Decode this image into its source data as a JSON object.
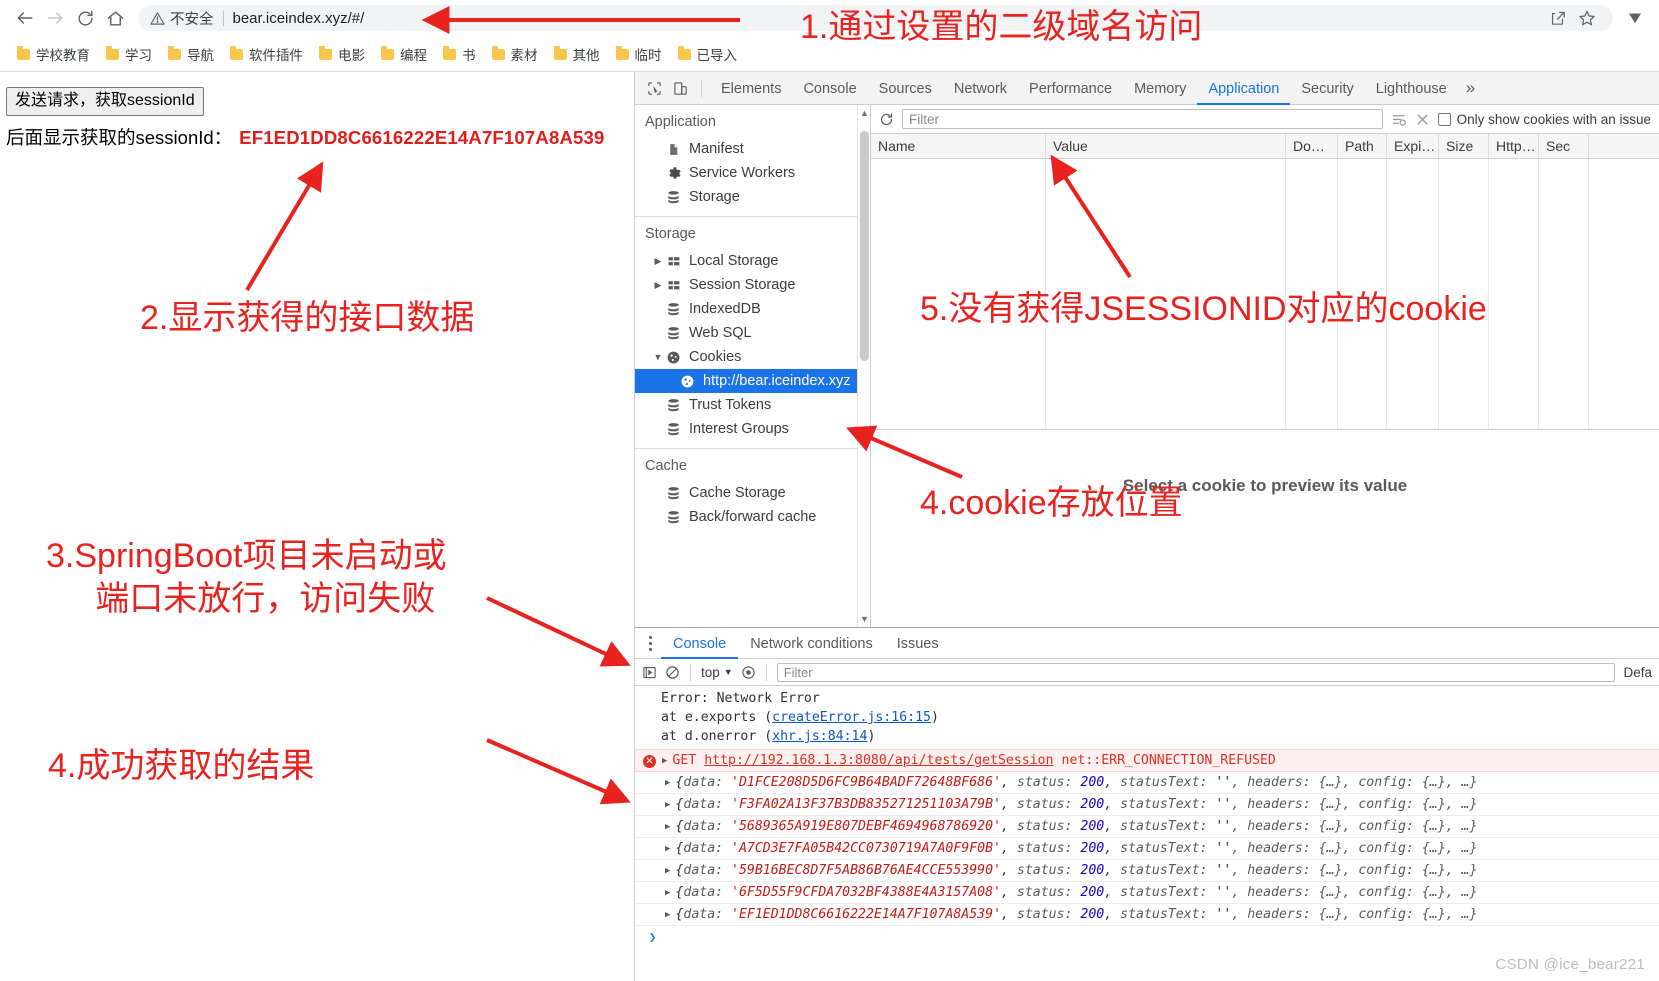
{
  "browser": {
    "nav": {
      "back": "back-arrow",
      "forward": "forward-arrow",
      "reload": "reload",
      "home": "home"
    },
    "omnibox": {
      "security_label": "不安全",
      "url": "bear.iceindex.xyz/#/",
      "share_icon": "share-icon",
      "star_icon": "star-icon",
      "menu_icon": "chevron-down-icon"
    },
    "bookmarks": [
      {
        "label": "学校教育"
      },
      {
        "label": "学习"
      },
      {
        "label": "导航"
      },
      {
        "label": "软件插件"
      },
      {
        "label": "电影"
      },
      {
        "label": "编程"
      },
      {
        "label": "书"
      },
      {
        "label": "素材"
      },
      {
        "label": "其他"
      },
      {
        "label": "临时"
      },
      {
        "label": "已导入"
      }
    ]
  },
  "page": {
    "send_button": "发送请求，获取sessionId",
    "session_label": "后面显示获取的sessionId：",
    "session_value": "EF1ED1DD8C6616222E14A7F107A8A539"
  },
  "devtools": {
    "tabs": [
      {
        "label": "Elements",
        "active": false
      },
      {
        "label": "Console",
        "active": false
      },
      {
        "label": "Sources",
        "active": false
      },
      {
        "label": "Network",
        "active": false
      },
      {
        "label": "Performance",
        "active": false
      },
      {
        "label": "Memory",
        "active": false
      },
      {
        "label": "Application",
        "active": true
      },
      {
        "label": "Security",
        "active": false
      },
      {
        "label": "Lighthouse",
        "active": false
      }
    ],
    "more": "»",
    "sidebar": {
      "groups": [
        {
          "title": "Application",
          "items": [
            {
              "label": "Manifest",
              "icon": "manifest-icon",
              "indent": 1
            },
            {
              "label": "Service Workers",
              "icon": "gear-icon",
              "indent": 1
            },
            {
              "label": "Storage",
              "icon": "database-icon",
              "indent": 1
            }
          ]
        },
        {
          "title": "Storage",
          "items": [
            {
              "label": "Local Storage",
              "icon": "table-icon",
              "indent": 1,
              "expandable": true,
              "expanded": false
            },
            {
              "label": "Session Storage",
              "icon": "table-icon",
              "indent": 1,
              "expandable": true,
              "expanded": false
            },
            {
              "label": "IndexedDB",
              "icon": "database-icon",
              "indent": 1
            },
            {
              "label": "Web SQL",
              "icon": "database-icon",
              "indent": 1
            },
            {
              "label": "Cookies",
              "icon": "cookie-icon",
              "indent": 1,
              "expandable": true,
              "expanded": true
            },
            {
              "label": "http://bear.iceindex.xyz",
              "icon": "cookie-icon",
              "indent": 2,
              "selected": true
            },
            {
              "label": "Trust Tokens",
              "icon": "database-icon",
              "indent": 1
            },
            {
              "label": "Interest Groups",
              "icon": "database-icon",
              "indent": 1
            }
          ]
        },
        {
          "title": "Cache",
          "items": [
            {
              "label": "Cache Storage",
              "icon": "database-icon",
              "indent": 1
            },
            {
              "label": "Back/forward cache",
              "icon": "database-icon",
              "indent": 1
            }
          ]
        }
      ]
    },
    "cookie_panel": {
      "filter_placeholder": "Filter",
      "clear_icon": "clear-icon",
      "refresh_icon": "refresh-icon",
      "only_issue_label": "Only show cookies with an issue",
      "columns": [
        "Name",
        "Value",
        "Do…",
        "Path",
        "Expi…",
        "Size",
        "Http…",
        "Sec"
      ],
      "rows": [],
      "empty_message": "Select a cookie to preview its value"
    },
    "drawer": {
      "tabs": [
        {
          "label": "Console",
          "active": true
        },
        {
          "label": "Network conditions",
          "active": false
        },
        {
          "label": "Issues",
          "active": false
        }
      ],
      "toolbar": {
        "execute_icon": "execute-icon",
        "clear_icon": "no-entry-icon",
        "context": "top",
        "eye_icon": "eye-icon",
        "filter_placeholder": "Filter",
        "levels": "Defa"
      },
      "messages": [
        {
          "type": "stack",
          "lines": [
            "Error: Network Error",
            "    at e.exports (createError.js:16:15)",
            "    at d.onerror (xhr.js:84:14)"
          ],
          "links": [
            "createError.js:16:15",
            "xhr.js:84:14"
          ]
        },
        {
          "type": "error",
          "method": "GET",
          "url": "http://192.168.1.3:8080/api/tests/getSession",
          "status": "net::ERR_CONNECTION_REFUSED"
        },
        {
          "type": "object",
          "data": "D1FCE208D5D6FC9B64BADF72648BF686",
          "status": "200",
          "statusText": "''"
        },
        {
          "type": "object",
          "data": "F3FA02A13F37B3DB835271251103A79B",
          "status": "200",
          "statusText": "''"
        },
        {
          "type": "object",
          "data": "5689365A919E807DEBF4694968786920",
          "status": "200",
          "statusText": "''"
        },
        {
          "type": "object",
          "data": "A7CD3E7FA05B42CC0730719A7A0F9F0B",
          "status": "200",
          "statusText": "''"
        },
        {
          "type": "object",
          "data": "59B16BEC8D7F5AB86B76AE4CCE553990",
          "status": "200",
          "statusText": "''"
        },
        {
          "type": "object",
          "data": "6F5D55F9CFDA7032BF4388E4A3157A08",
          "status": "200",
          "statusText": "''"
        },
        {
          "type": "object",
          "data": "EF1ED1DD8C6616222E14A7F107A8A539",
          "status": "200",
          "statusText": "''"
        }
      ],
      "object_tail": ", headers: {…}, config: {…}, …}"
    }
  },
  "annotations": {
    "a1": "1.通过设置的二级域名访问",
    "a2": "2.显示获得的接口数据",
    "a3_line1": "3.SpringBoot项目未启动或",
    "a3_line2": "端口未放行，访问失败",
    "a4_left": "4.成功获取的结果",
    "a4_right": "4.cookie存放位置",
    "a5": "5.没有获得JSESSIONID对应的cookie",
    "color": "#e8231f"
  },
  "watermark": "CSDN @ice_bear221"
}
